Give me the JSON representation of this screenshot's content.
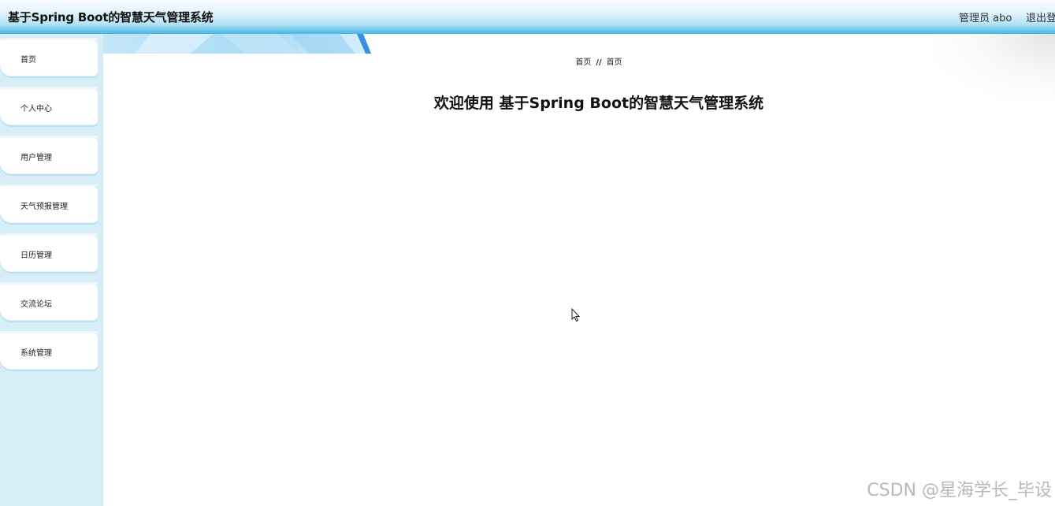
{
  "header": {
    "title": "基于Spring Boot的智慧天气管理系统",
    "user_label": "管理员 abo",
    "logout_label": "退出登"
  },
  "sidebar": {
    "items": [
      {
        "label": "首页"
      },
      {
        "label": "个人中心"
      },
      {
        "label": "用户管理"
      },
      {
        "label": "天气预报管理"
      },
      {
        "label": "日历管理"
      },
      {
        "label": "交流论坛"
      },
      {
        "label": "系统管理"
      }
    ]
  },
  "breadcrumb": {
    "first": "首页",
    "separator": "//",
    "second": "首页"
  },
  "main": {
    "welcome_text": "欢迎使用 基于Spring Boot的智慧天气管理系统"
  },
  "watermark": "CSDN @星海学长_毕设",
  "colors": {
    "header_accent": "#45b8e4",
    "sidebar_bg": "#d7eef8"
  }
}
